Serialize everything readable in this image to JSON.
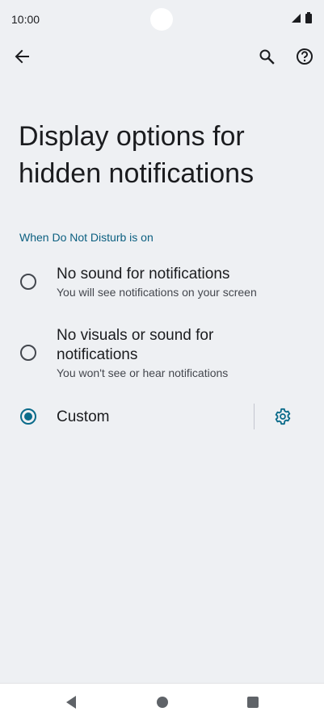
{
  "status_bar": {
    "time": "10:00",
    "signal_icon": "cell-signal-icon",
    "battery_icon": "battery-icon"
  },
  "toolbar": {
    "back_icon": "arrow-back-icon",
    "search_icon": "search-icon",
    "help_icon": "help-icon"
  },
  "page": {
    "title": "Display options for hidden notifications",
    "section_header": "When Do Not Disturb is on"
  },
  "options": [
    {
      "title": "No sound for notifications",
      "subtitle": "You will see notifications on your screen",
      "selected": false
    },
    {
      "title": "No visuals or sound for notifications",
      "subtitle": "You won't see or hear notifications",
      "selected": false
    },
    {
      "title": "Custom",
      "subtitle": "",
      "selected": true,
      "settings_icon": "gear-icon"
    }
  ],
  "nav_bar": {
    "back_icon": "nav-back-triangle-icon",
    "home_icon": "nav-home-circle-icon",
    "recents_icon": "nav-recents-square-icon"
  },
  "colors": {
    "accent": "#0b6b8a",
    "section_header": "#0b5f80",
    "background": "#eef0f3"
  }
}
